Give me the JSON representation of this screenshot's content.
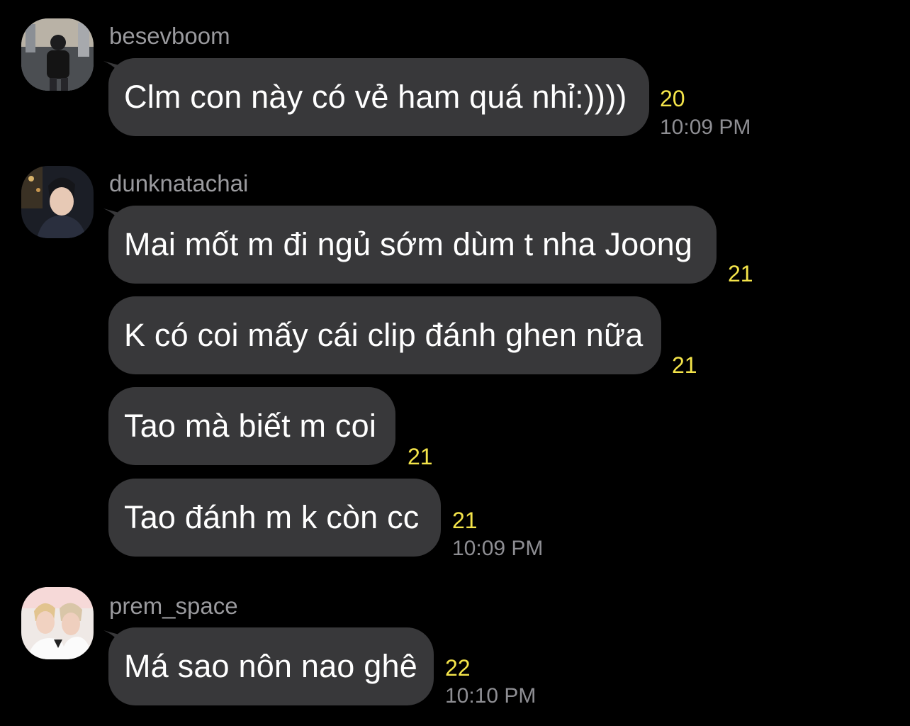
{
  "colors": {
    "background": "#000000",
    "bubble": "#38383a",
    "message_text": "#ffffff",
    "username": "#9a9a9e",
    "count": "#f4e44a",
    "timestamp": "#8e8e93"
  },
  "messages": [
    {
      "sender": "besevboom",
      "avatar_icon": "user-photo-avatar",
      "bubbles": [
        {
          "text": "Clm con này có vẻ ham quá nhỉ:))))",
          "count": "20",
          "time": "10:09 PM"
        }
      ]
    },
    {
      "sender": "dunknatachai",
      "avatar_icon": "user-photo-avatar",
      "bubbles": [
        {
          "text": "Mai mốt m đi ngủ sớm dùm t nha Joong",
          "count": "21"
        },
        {
          "text": "K có coi mấy cái clip đánh ghen nữa",
          "count": "21"
        },
        {
          "text": "Tao mà biết m coi",
          "count": "21"
        },
        {
          "text": "Tao đánh m k còn cc",
          "count": "21",
          "time": "10:09 PM"
        }
      ]
    },
    {
      "sender": "prem_space",
      "avatar_icon": "user-photo-avatar",
      "bubbles": [
        {
          "text": "Má sao nôn nao ghê",
          "count": "22",
          "time": "10:10 PM"
        }
      ]
    }
  ]
}
